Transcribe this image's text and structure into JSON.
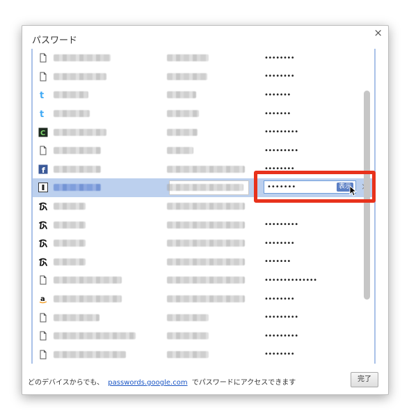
{
  "dialog": {
    "title": "パスワード",
    "close": "×"
  },
  "rows": [
    {
      "icon": "page-icon",
      "password": "••••••••",
      "site_w": 82,
      "user_w": 60
    },
    {
      "icon": "page-icon",
      "password": "••••••••",
      "site_w": 76,
      "user_w": 58
    },
    {
      "icon": "twitter-icon",
      "password": "•••••••",
      "site_w": 50,
      "user_w": 42
    },
    {
      "icon": "twitter-icon",
      "password": "•••••••",
      "site_w": 52,
      "user_w": 46
    },
    {
      "icon": "c-icon",
      "password": "•••••••••",
      "site_w": 76,
      "user_w": 44
    },
    {
      "icon": "page-icon",
      "password": "•••••••••",
      "site_w": 68,
      "user_w": 38
    },
    {
      "icon": "facebook-icon",
      "password": "••••••••",
      "site_w": 68,
      "user_w": 112
    },
    {
      "icon": "i-icon",
      "password": "•••••••",
      "site_w": 68,
      "user_w": 110,
      "selected": true
    },
    {
      "icon": "calligraphy-icon",
      "password": "",
      "site_w": 46,
      "user_w": 112
    },
    {
      "icon": "calligraphy-icon",
      "password": "•••••••••",
      "site_w": 46,
      "user_w": 112
    },
    {
      "icon": "calligraphy-icon",
      "password": "••••••••",
      "site_w": 46,
      "user_w": 112
    },
    {
      "icon": "calligraphy-icon",
      "password": "•••••••",
      "site_w": 46,
      "user_w": 112
    },
    {
      "icon": "page-icon",
      "password": "••••••••••••••",
      "site_w": 98,
      "user_w": 112
    },
    {
      "icon": "amazon-icon",
      "password": "••••••••",
      "site_w": 98,
      "user_w": 112
    },
    {
      "icon": "page-icon",
      "password": "•••••••••",
      "site_w": 66,
      "user_w": 60
    },
    {
      "icon": "page-icon",
      "password": "•••••••••",
      "site_w": 118,
      "user_w": 60
    },
    {
      "icon": "page-icon",
      "password": "••••••••",
      "site_w": 104,
      "user_w": 60
    }
  ],
  "selected_row": {
    "password_value": "•••••••",
    "show_button": "表示",
    "remove": "×"
  },
  "footer": {
    "text_before": "どのデバイスからでも、",
    "link": "passwords.google.com",
    "text_after": "でパスワードにアクセスできます",
    "done_button": "完了"
  }
}
